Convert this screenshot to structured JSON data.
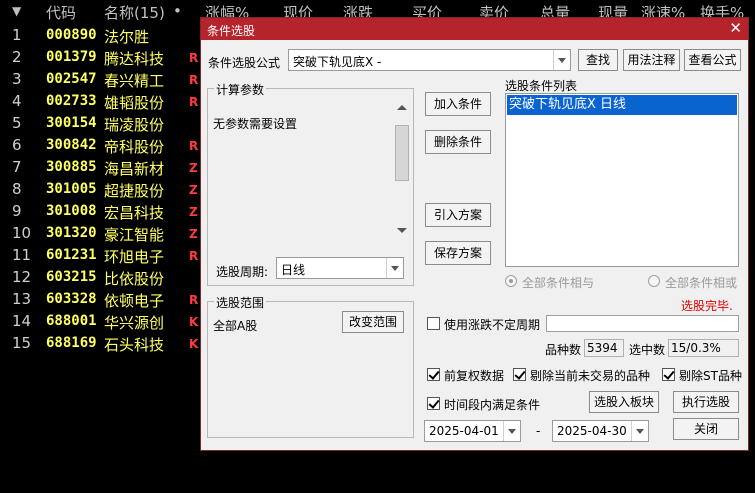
{
  "list": {
    "headers": {
      "sort_arrow": "▼",
      "code": "代码",
      "name": "名称(15)",
      "dot": "•",
      "pct_change": "涨幅%",
      "price": "现价",
      "change": "涨跌",
      "bid": "买价",
      "ask": "卖价",
      "volume": "总量",
      "cur_volume": "现量",
      "speed": "涨速%",
      "turnover": "换手%"
    },
    "rows": [
      {
        "idx": "1",
        "code": "000890",
        "name": "法尔胜",
        "flag": ""
      },
      {
        "idx": "2",
        "code": "001379",
        "name": "腾达科技",
        "flag": "R"
      },
      {
        "idx": "3",
        "code": "002547",
        "name": "春兴精工",
        "flag": "R"
      },
      {
        "idx": "4",
        "code": "002733",
        "name": "雄韬股份",
        "flag": "R"
      },
      {
        "idx": "5",
        "code": "300154",
        "name": "瑞凌股份",
        "flag": ""
      },
      {
        "idx": "6",
        "code": "300842",
        "name": "帝科股份",
        "flag": "R"
      },
      {
        "idx": "7",
        "code": "300885",
        "name": "海昌新材",
        "flag": "Z"
      },
      {
        "idx": "8",
        "code": "301005",
        "name": "超捷股份",
        "flag": "Z"
      },
      {
        "idx": "9",
        "code": "301008",
        "name": "宏昌科技",
        "flag": "Z"
      },
      {
        "idx": "10",
        "code": "301320",
        "name": "豪江智能",
        "flag": "Z"
      },
      {
        "idx": "11",
        "code": "601231",
        "name": "环旭电子",
        "flag": "R"
      },
      {
        "idx": "12",
        "code": "603215",
        "name": "比依股份",
        "flag": ""
      },
      {
        "idx": "13",
        "code": "603328",
        "name": "依顿电子",
        "flag": "R"
      },
      {
        "idx": "14",
        "code": "688001",
        "name": "华兴源创",
        "flag": "K"
      },
      {
        "idx": "15",
        "code": "688169",
        "name": "石头科技",
        "flag": "K"
      }
    ]
  },
  "dialog": {
    "title": "条件选股",
    "close_glyph": "✕",
    "formula_label": "条件选股公式",
    "formula_value": "突破下轨见底X  -",
    "find_btn": "查找",
    "usage_btn": "用法注释",
    "view_btn": "查看公式",
    "params_group": "计算参数",
    "params_text": "无参数需要设置",
    "period_label": "选股周期:",
    "period_value": "日线",
    "add_btn": "加入条件",
    "delete_btn": "删除条件",
    "import_btn": "引入方案",
    "save_btn": "保存方案",
    "cond_list_label": "选股条件列表",
    "cond_items": [
      "突破下轨见底X  日线"
    ],
    "radio_and": "全部条件相与",
    "radio_or": "全部条件相或",
    "status_text": "选股完毕.",
    "range_group": "选股范围",
    "range_text": "全部A股",
    "change_range_btn": "改变范围",
    "use_period_label": "使用涨跌不定周期",
    "count_label": "品种数",
    "count_value": "5394",
    "selected_label": "选中数",
    "selected_value": "15/0.3%",
    "prefq_label": "前复权数据",
    "exclude_untraded_label": "剔除当前未交易的品种",
    "exclude_st_label": "剔除ST品种",
    "time_range_label": "时间段内满足条件",
    "to_board_btn": "选股入板块",
    "execute_btn": "执行选股",
    "date_from": "2025-04-01",
    "date_sep": "-",
    "date_to": "2025-04-30",
    "close_btn": "关闭"
  },
  "colors": {
    "title_bar": "#b5232b",
    "stock_text": "#ffff66",
    "flag_text": "#ff3b3b",
    "selection": "#0a64d0",
    "status_text": "#e00000"
  }
}
